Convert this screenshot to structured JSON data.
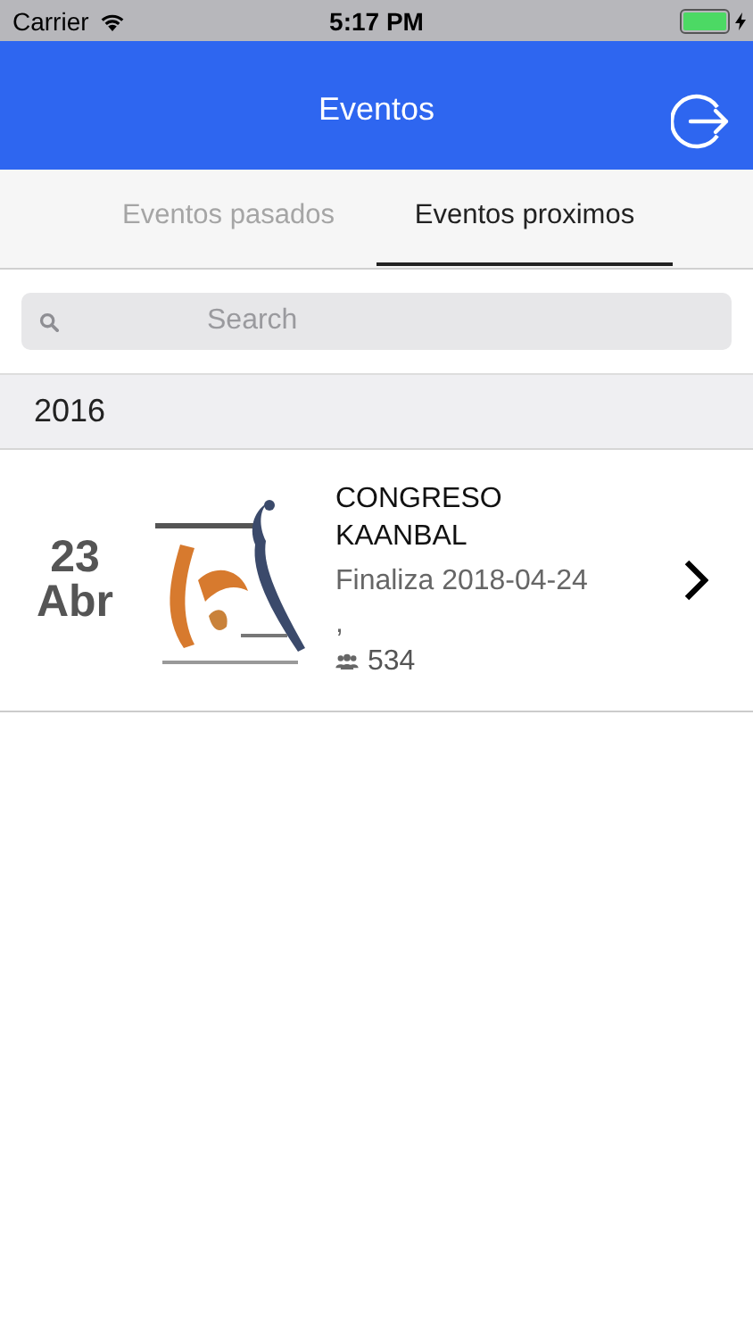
{
  "status_bar": {
    "carrier": "Carrier",
    "time": "5:17 PM"
  },
  "nav": {
    "title": "Eventos"
  },
  "tabs": [
    {
      "label": "Eventos pasados",
      "selected": false
    },
    {
      "label": "Eventos proximos",
      "selected": true
    }
  ],
  "search": {
    "placeholder": "Search"
  },
  "sections": [
    {
      "header": "2016",
      "events": [
        {
          "day": "23",
          "month": "Abr",
          "title": "CONGRESO KAANBAL",
          "ends": "Finaliza 2018-04-24",
          "location": ",",
          "attendees": "534"
        }
      ]
    }
  ]
}
